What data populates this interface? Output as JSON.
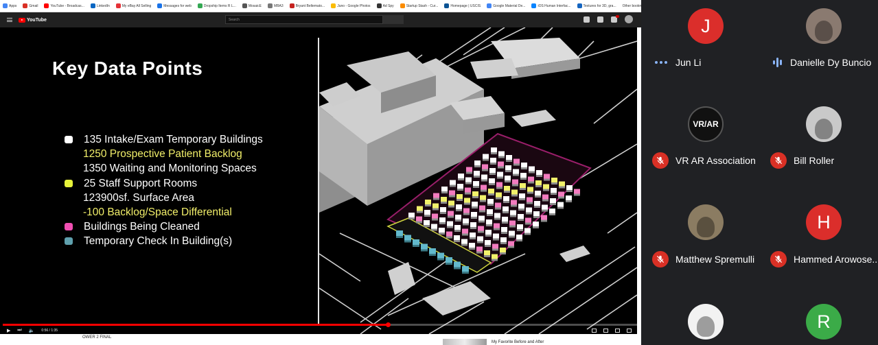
{
  "browser": {
    "bookmarks": [
      "Apps",
      "Gmail",
      "YouTube - Broadcas...",
      "LinkedIn",
      "My eBay All Selling",
      "Messages for web",
      "Dropship Items R L...",
      "MosaicE",
      "MBA3",
      "Bryant Beltemato...",
      "Juno - Google Photos",
      "Ad Spy",
      "Startup Stash - Cur...",
      "Homepage | USCIS",
      "Google Material De...",
      "iOS Human Interfac...",
      "Textures for 3D, gra..."
    ],
    "other_bookmarks": "Other bookmarks"
  },
  "youtube": {
    "logo": "YouTube",
    "search_placeholder": "Search",
    "notification_count": "9+",
    "time": "0:56 / 1:35",
    "progress_fraction": 0.607,
    "below_left": "OWER 2 FINAL",
    "below_right": "My Favorite Before and After"
  },
  "slide": {
    "title": "Key Data Points",
    "legend": [
      {
        "text": "135 Intake/Exam Temporary Buildings",
        "dot": "#ffffff",
        "style": "dot"
      },
      {
        "text": "1250 Prospective Patient Backlog",
        "style": "indent-yellow"
      },
      {
        "text": "1350 Waiting and Monitoring Spaces",
        "style": "indent"
      },
      {
        "text": "25 Staff Support Rooms",
        "dot": "#e6f23a",
        "style": "dot"
      },
      {
        "text": "123900sf. Surface Area",
        "style": "indent"
      },
      {
        "text": "-100 Backlog/Space Differential",
        "style": "indent-yellow"
      },
      {
        "text": "Buildings Being Cleaned",
        "dot": "#f04fb2",
        "style": "dot"
      },
      {
        "text": "Temporary Check In Building(s)",
        "dot": "#5fa0ad",
        "style": "dot"
      }
    ],
    "colors": {
      "white": "#ffffff",
      "yellow": "#f2f26b",
      "pink": "#f37bbf",
      "teal": "#62b9cc",
      "magenta_border": "#9a1e6a",
      "yellow_border": "#cfd640"
    }
  },
  "participants": [
    {
      "name": "Jun Li",
      "initial": "J",
      "avatar_color": "#db2e2b",
      "status": "speaking-dots"
    },
    {
      "name": "Danielle Dy Buncio",
      "initial": "",
      "avatar_color": "#8a7a70",
      "status": "speaking-wave"
    },
    {
      "name": "VR AR Association",
      "initial": "VR/AR",
      "avatar_color": "#111111",
      "status": "muted"
    },
    {
      "name": "Bill Roller",
      "initial": "",
      "avatar_color": "#c9c9c9",
      "status": "muted"
    },
    {
      "name": "Matthew Spremulli",
      "initial": "",
      "avatar_color": "#8b7c62",
      "status": "muted"
    },
    {
      "name": "Hammed Arowose...",
      "initial": "H",
      "avatar_color": "#db2e2b",
      "status": "muted"
    },
    {
      "name": "",
      "initial": "",
      "avatar_color": "#f2f2f2",
      "status": "none"
    },
    {
      "name": "",
      "initial": "R",
      "avatar_color": "#3bab48",
      "status": "none"
    }
  ]
}
